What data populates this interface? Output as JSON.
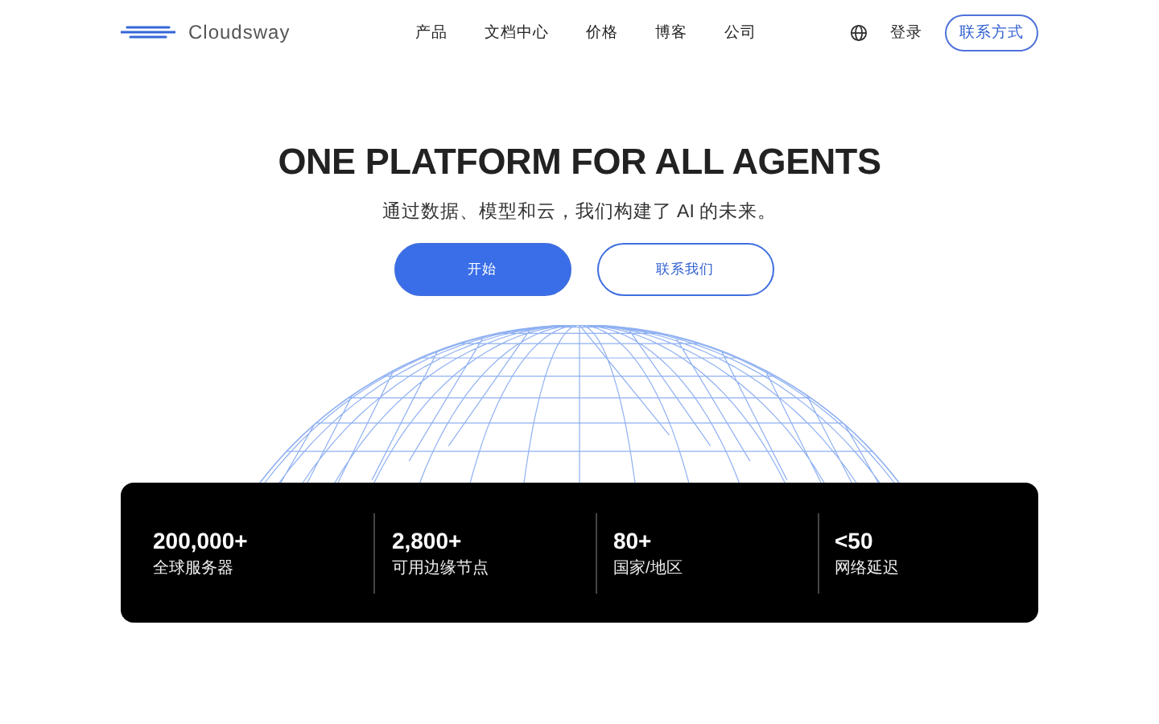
{
  "header": {
    "logo_text": "Cloudsway",
    "nav": [
      "产品",
      "文档中心",
      "价格",
      "博客",
      "公司"
    ],
    "login": "登录",
    "contact_button": "联系方式"
  },
  "hero": {
    "title": "ONE PLATFORM FOR ALL AGENTS",
    "subtitle": "通过数据、模型和云，我们构建了 AI 的未来。",
    "primary_button": "开始",
    "secondary_button": "联系我们"
  },
  "stats": [
    {
      "value": "200,000+",
      "label": "全球服务器"
    },
    {
      "value": "2,800+",
      "label": "可用边缘节点"
    },
    {
      "value": "80+",
      "label": "国家/地区"
    },
    {
      "value": "<50",
      "label": "网络延迟"
    }
  ]
}
